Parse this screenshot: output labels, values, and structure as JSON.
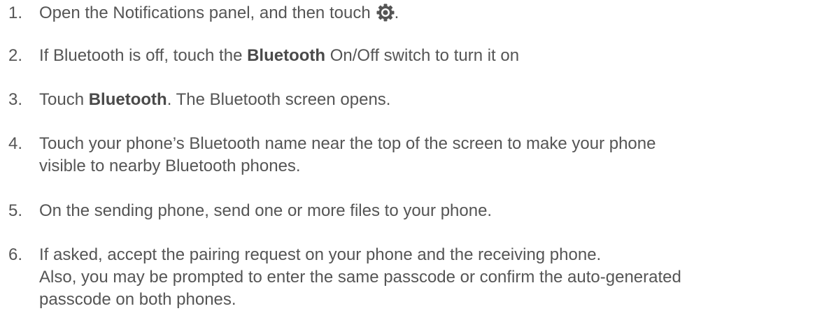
{
  "steps": [
    {
      "number": "1.",
      "text_before": "Open the Notifications panel, and then touch",
      "icon": "gear-icon",
      "text_after": "."
    },
    {
      "number": "2.",
      "text_before": "If Bluetooth is off, touch the ",
      "bold": "Bluetooth",
      "text_after": " On/Off switch to turn it on"
    },
    {
      "number": "3.",
      "text_before": "Touch ",
      "bold": "Bluetooth",
      "text_after": ". The Bluetooth screen opens."
    },
    {
      "number": "4.",
      "line1": "Touch your phone’s Bluetooth name near the top of the screen to make your phone",
      "line2": "visible to nearby Bluetooth phones."
    },
    {
      "number": "5.",
      "text": "On the sending phone, send one or more files to your phone."
    },
    {
      "number": "6.",
      "line1": "If asked, accept the pairing request on your phone and the receiving phone.",
      "line2": "Also, you may be prompted to enter the same passcode or confirm the auto-generated",
      "line3": "passcode on both phones."
    }
  ],
  "colors": {
    "text": "#555555",
    "icon": "#555555"
  }
}
